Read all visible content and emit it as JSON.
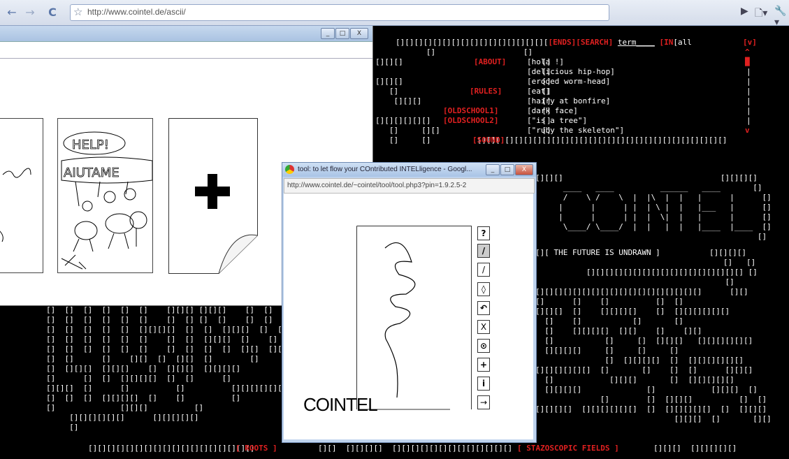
{
  "browser": {
    "back_icon": "←",
    "forward_icon": "→",
    "reload_icon": "C",
    "star_icon": "☆",
    "url": "http://www.cointel.de/ascii/",
    "play_icon": "▶",
    "page_icon": "🗋▾",
    "wrench_icon": "🔧▾"
  },
  "ascii_right": {
    "search_row_boxes": "[][][][][][][][][][][][][][][][][",
    "ends": "[ENDS]",
    "search": "[SEARCH]",
    "term": "term____",
    "in": "[IN",
    "all": "[all",
    "v_down": "[v]",
    "results": [
      "[hola !]",
      "[delicious hip-hop]",
      "[eroded worm-head]",
      "[eat]",
      "[hairy at bonfire]",
      "[dark face]",
      "[\"is a tree\"]",
      "[\"ruby the skeleton\"]"
    ],
    "menu": [
      "[ABOUT]",
      "[RULES]",
      "[OLDSCHOOL1]",
      "[OLDSCHOOL2]",
      "[SOUND]"
    ],
    "future": "[][ THE FUTURE IS UNDRAWN ]",
    "stazo": "[ STAZOSCOPIC FIELDS ]",
    "roots": "[ ROOTS ]"
  },
  "drawing_window": {
    "minimize": "_",
    "restore": "□",
    "close": "X"
  },
  "tool_window": {
    "title": "tool: to let flow your COntributed INTELligence - Googl...",
    "url": "http://www.cointel.de/~cointel/tool/tool.php3?pin=1.9.2.5-2",
    "signature": "COINTEL",
    "tools": [
      "?",
      "/",
      "/",
      "◊",
      "↶",
      "X",
      "⊙",
      "+",
      "i",
      "→"
    ]
  },
  "cards": {
    "plus": "+"
  }
}
